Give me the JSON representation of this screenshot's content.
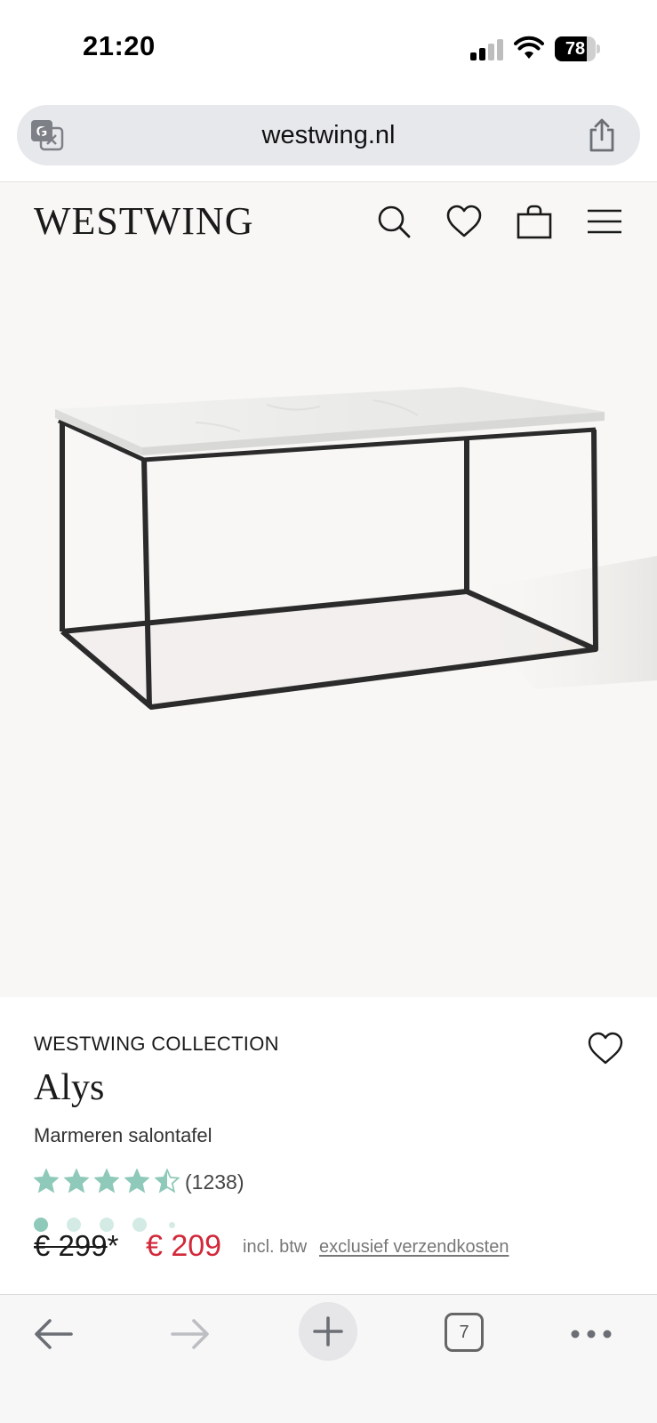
{
  "status_bar": {
    "time": "21:20",
    "battery": "78",
    "battery_level": 0.78,
    "signal_bars": 2,
    "icons": [
      "signal-icon",
      "wifi-icon",
      "battery-icon"
    ]
  },
  "browser": {
    "url": "westwing.nl",
    "icons": [
      "translate-icon",
      "share-icon"
    ]
  },
  "site_header": {
    "logo": "WESTWING",
    "icons": [
      "search-icon",
      "heart-icon",
      "bag-icon",
      "menu-icon"
    ]
  },
  "gallery": {
    "image_label": "coffee-table",
    "dots_total": 5,
    "active_dot": 1
  },
  "product": {
    "brand": "WESTWING COLLECTION",
    "name": "Alys",
    "subtitle": "Marmeren salontafel",
    "rating": 4.5,
    "review_count": "(1238)",
    "price_old": "€ 299",
    "price_old_mark": "*",
    "price_new": "€ 209",
    "tax_note": "incl. btw",
    "shipping_link": "exclusief verzendkosten"
  },
  "colors": {
    "accent_green": "#8fc9b9",
    "sale_red": "#d2283a",
    "page_bg": "#f8f7f5"
  },
  "bottom_bar": {
    "tab_count": "7",
    "icons": [
      "back-arrow-icon",
      "forward-arrow-icon",
      "plus-icon",
      "tabs-icon",
      "more-icon"
    ]
  }
}
